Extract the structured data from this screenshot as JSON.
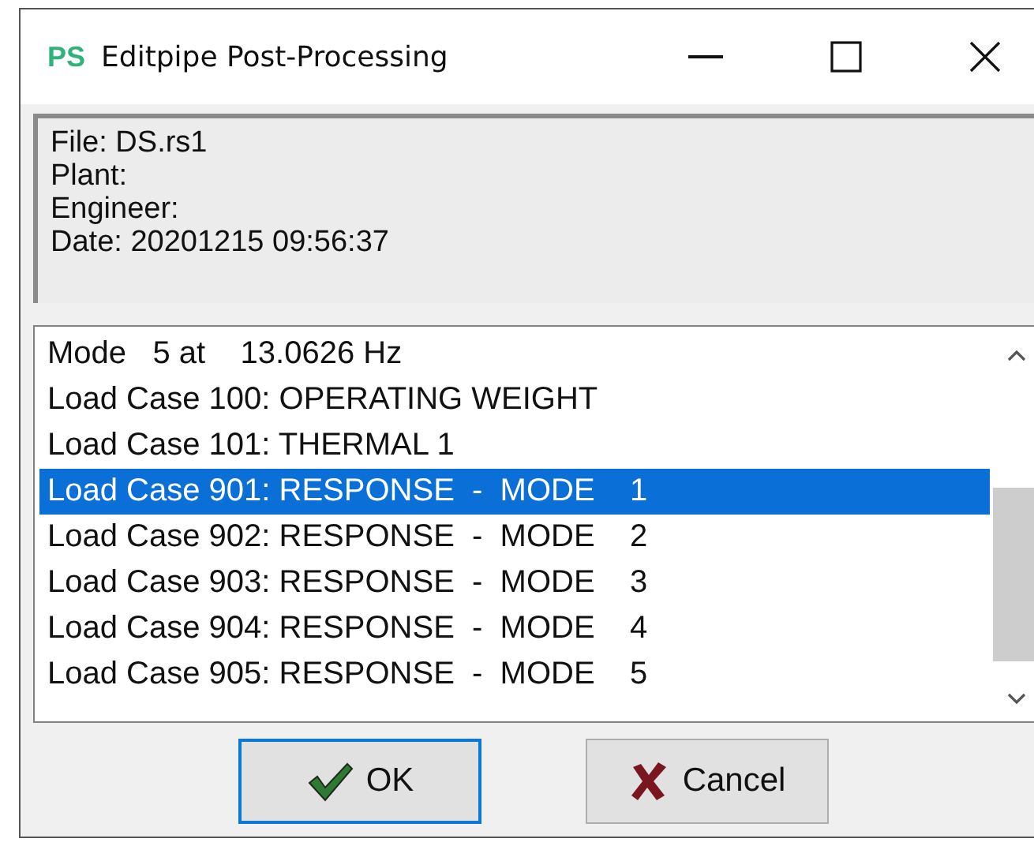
{
  "window": {
    "app_badge": "PS",
    "title": "Editpipe Post-Processing"
  },
  "info": [
    "File: DS.rs1",
    "Plant:",
    "Engineer:",
    "Date: 20201215  09:56:37"
  ],
  "list": [
    {
      "text": "Mode   5 at    13.0626 Hz",
      "selected": false
    },
    {
      "text": "Load Case 100: OPERATING WEIGHT",
      "selected": false
    },
    {
      "text": "Load Case 101: THERMAL 1",
      "selected": false
    },
    {
      "text": "Load Case 901: RESPONSE  -  MODE    1",
      "selected": true
    },
    {
      "text": "Load Case 902: RESPONSE  -  MODE    2",
      "selected": false
    },
    {
      "text": "Load Case 903: RESPONSE  -  MODE    3",
      "selected": false
    },
    {
      "text": "Load Case 904: RESPONSE  -  MODE    4",
      "selected": false
    },
    {
      "text": "Load Case 905: RESPONSE  -  MODE    5",
      "selected": false
    }
  ],
  "buttons": [
    {
      "label": "OK",
      "kind": "ok",
      "focused": true
    },
    {
      "label": "Cancel",
      "kind": "cancel",
      "focused": false
    }
  ]
}
